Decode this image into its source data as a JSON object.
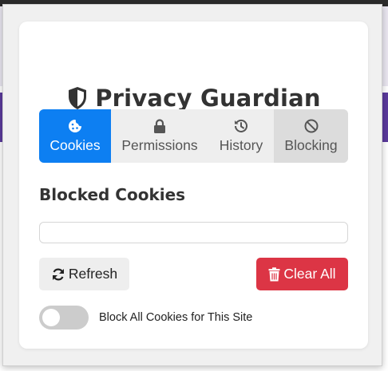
{
  "app": {
    "title": "Privacy Guardian",
    "accent_color": "#0d7ff2",
    "danger_color": "#dc3545"
  },
  "tabs": [
    {
      "label": "Cookies",
      "icon": "cookie-icon",
      "active": true
    },
    {
      "label": "Permissions",
      "icon": "lock-icon",
      "active": false
    },
    {
      "label": "History",
      "icon": "history-icon",
      "active": false
    },
    {
      "label": "Blocking",
      "icon": "ban-icon",
      "active": false
    }
  ],
  "cookies_panel": {
    "heading": "Blocked Cookies",
    "refresh_label": "Refresh",
    "clear_all_label": "Clear All",
    "toggle_label": "Block All Cookies for This Site",
    "toggle_on": false
  }
}
